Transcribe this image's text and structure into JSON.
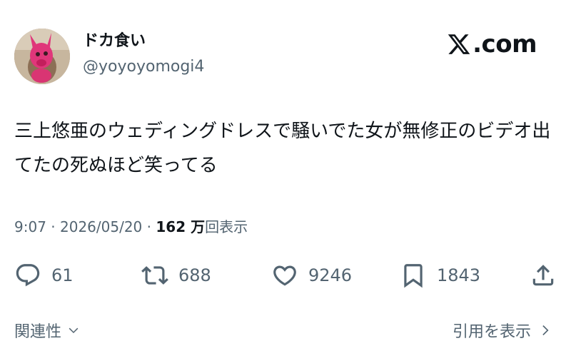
{
  "author": {
    "display_name": "ドカ食い",
    "handle": "@yoyoyomogi4"
  },
  "brand": {
    "text": ".com"
  },
  "tweet": {
    "text": "三上悠亜のウェディングドレスで騒いでた女が無修正のビデオ出てたの死ぬほど笑ってる"
  },
  "meta": {
    "time": "9:07",
    "separator": " · ",
    "date": "2026/05/20",
    "views_count": "162 万",
    "views_label": "回表示"
  },
  "actions": {
    "replies": "61",
    "reposts": "688",
    "likes": "9246",
    "bookmarks": "1843"
  },
  "footer": {
    "related_label": "関連性",
    "quotes_label": "引用を表示"
  },
  "colors": {
    "text_primary": "#0f1419",
    "text_secondary": "#536471",
    "avatar_accent": "#e23a74"
  },
  "icons": {
    "reply": "speech-bubble-icon",
    "repost": "repost-arrows-icon",
    "like": "heart-icon",
    "bookmark": "bookmark-icon",
    "share": "share-upload-icon"
  }
}
